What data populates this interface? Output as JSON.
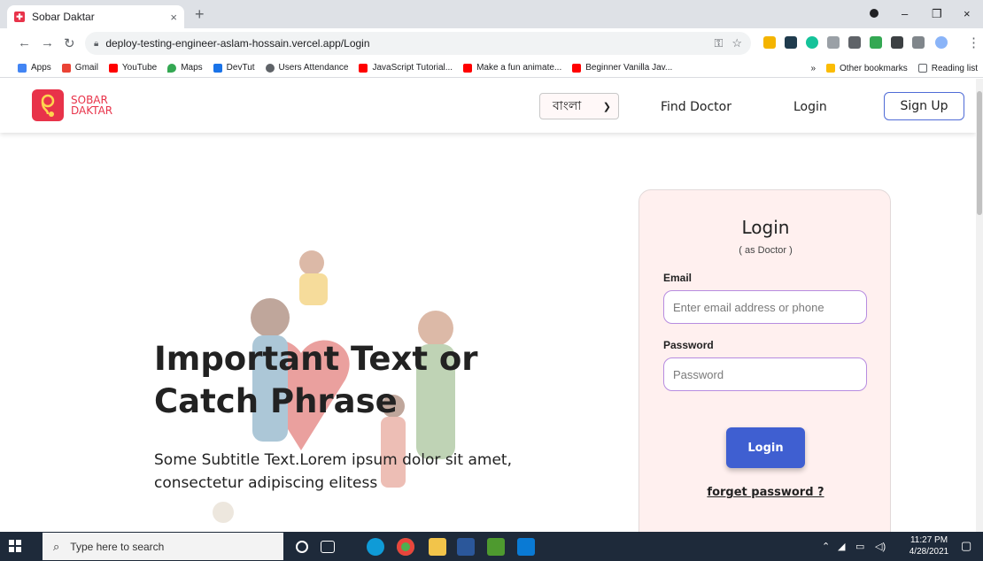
{
  "browser": {
    "tab_title": "Sobar Daktar",
    "tab_close": "×",
    "new_tab": "+",
    "url": "deploy-testing-engineer-aslam-hossain.vercel.app/Login",
    "window_controls": [
      "–",
      "❐",
      "×"
    ]
  },
  "bookmarks": {
    "items": [
      {
        "label": "Apps",
        "icon": "apps-grid-icon",
        "color": "#4285f4"
      },
      {
        "label": "Gmail",
        "icon": "gmail-icon",
        "color": "#ea4335"
      },
      {
        "label": "YouTube",
        "icon": "youtube-icon",
        "color": "#ff0000"
      },
      {
        "label": "Maps",
        "icon": "maps-pin-icon",
        "color": "#34a853"
      },
      {
        "label": "DevTut",
        "icon": "devtut-icon",
        "color": "#1a73e8"
      },
      {
        "label": "Users Attendance",
        "icon": "globe-icon",
        "color": "#5f6368"
      },
      {
        "label": "JavaScript Tutorial...",
        "icon": "youtube-icon",
        "color": "#ff0000"
      },
      {
        "label": "Make a fun animate...",
        "icon": "youtube-icon",
        "color": "#ff0000"
      },
      {
        "label": "Beginner Vanilla Jav...",
        "icon": "youtube-icon",
        "color": "#ff0000"
      }
    ],
    "more": "»",
    "other_bookmarks": "Other bookmarks",
    "reading_list": "Reading list"
  },
  "site": {
    "brand_line1": "SOBAR",
    "brand_line2": "DAKTAR",
    "brand_color": "#e8334a",
    "language_selected": "বাংলা",
    "nav_find_doctor": "Find Doctor",
    "nav_login": "Login",
    "nav_signup": "Sign Up",
    "accent_color": "#3f5fd1"
  },
  "hero": {
    "title_line1": "Important Text or",
    "title_line2": "Catch Phrase",
    "subtitle_line1": "Some Subtitle Text.Lorem ipsum dolor sit amet,",
    "subtitle_line2": "consectetur adipiscing elitess"
  },
  "login_card": {
    "title": "Login",
    "subtitle": "( as Doctor )",
    "email_label": "Email",
    "email_placeholder": "Enter email address or phone",
    "password_label": "Password",
    "password_placeholder": "Password",
    "submit_label": "Login",
    "forget_link": "forget password ?"
  },
  "taskbar": {
    "search_placeholder": "Type here to search",
    "time": "11:27 PM",
    "date": "4/28/2021"
  }
}
